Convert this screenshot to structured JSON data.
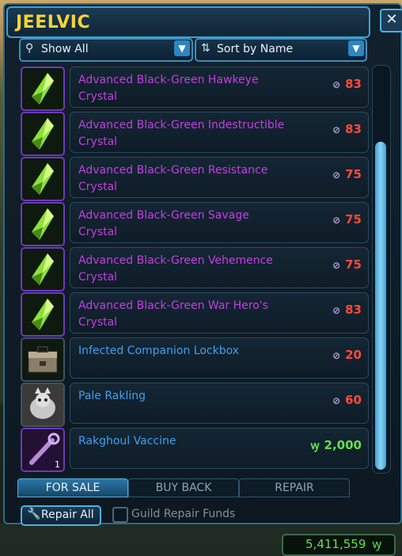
{
  "vendor": {
    "title": "JEELVIC",
    "close_label": "✕"
  },
  "filters": {
    "show": {
      "label": "Show All",
      "icon": "search-icon"
    },
    "sort": {
      "label": "Sort by Name",
      "icon": "sort-icon"
    }
  },
  "items": [
    {
      "name_line1": "Advanced Black-Green Hawkeye",
      "name_line2": "Crystal",
      "price": "83",
      "currency": "commendation",
      "rarity": "purple",
      "icon": "crystal-icon"
    },
    {
      "name_line1": "Advanced Black-Green Indestructible",
      "name_line2": "Crystal",
      "price": "83",
      "currency": "commendation",
      "rarity": "purple",
      "icon": "crystal-icon"
    },
    {
      "name_line1": "Advanced Black-Green Resistance",
      "name_line2": "Crystal",
      "price": "75",
      "currency": "commendation",
      "rarity": "purple",
      "icon": "crystal-icon"
    },
    {
      "name_line1": "Advanced Black-Green Savage",
      "name_line2": "Crystal",
      "price": "75",
      "currency": "commendation",
      "rarity": "purple",
      "icon": "crystal-icon"
    },
    {
      "name_line1": "Advanced Black-Green Vehemence",
      "name_line2": "Crystal",
      "price": "75",
      "currency": "commendation",
      "rarity": "purple",
      "icon": "crystal-icon"
    },
    {
      "name_line1": "Advanced Black-Green War Hero's",
      "name_line2": "Crystal",
      "price": "83",
      "currency": "commendation",
      "rarity": "purple",
      "icon": "crystal-icon"
    },
    {
      "name_line1": "Infected Companion Lockbox",
      "name_line2": "",
      "price": "20",
      "currency": "commendation",
      "rarity": "blue",
      "icon": "lockbox-icon"
    },
    {
      "name_line1": "Pale Rakling",
      "name_line2": "",
      "price": "60",
      "currency": "commendation",
      "rarity": "blue",
      "icon": "rakling-pet-icon"
    },
    {
      "name_line1": "Rakghoul Vaccine",
      "name_line2": "",
      "price": "2,000",
      "currency": "credits",
      "rarity": "blue",
      "icon": "vaccine-icon",
      "quantity": "1"
    }
  ],
  "tabs": [
    {
      "label": "FOR SALE",
      "active": true
    },
    {
      "label": "BUY BACK",
      "active": false
    },
    {
      "label": "REPAIR",
      "active": false
    }
  ],
  "repair": {
    "label": "Repair All",
    "guild_label": "Guild Repair Funds",
    "guild_checked": false
  },
  "credits": {
    "amount": "5,411,559",
    "symbol": "ꝡ"
  },
  "colors": {
    "title": "#f2d43a",
    "purple_item": "#c33ee3",
    "blue_item": "#3f9ff0",
    "price_red": "#ff4a3a",
    "price_green": "#62e04a",
    "border_blue": "#37a6d4"
  }
}
